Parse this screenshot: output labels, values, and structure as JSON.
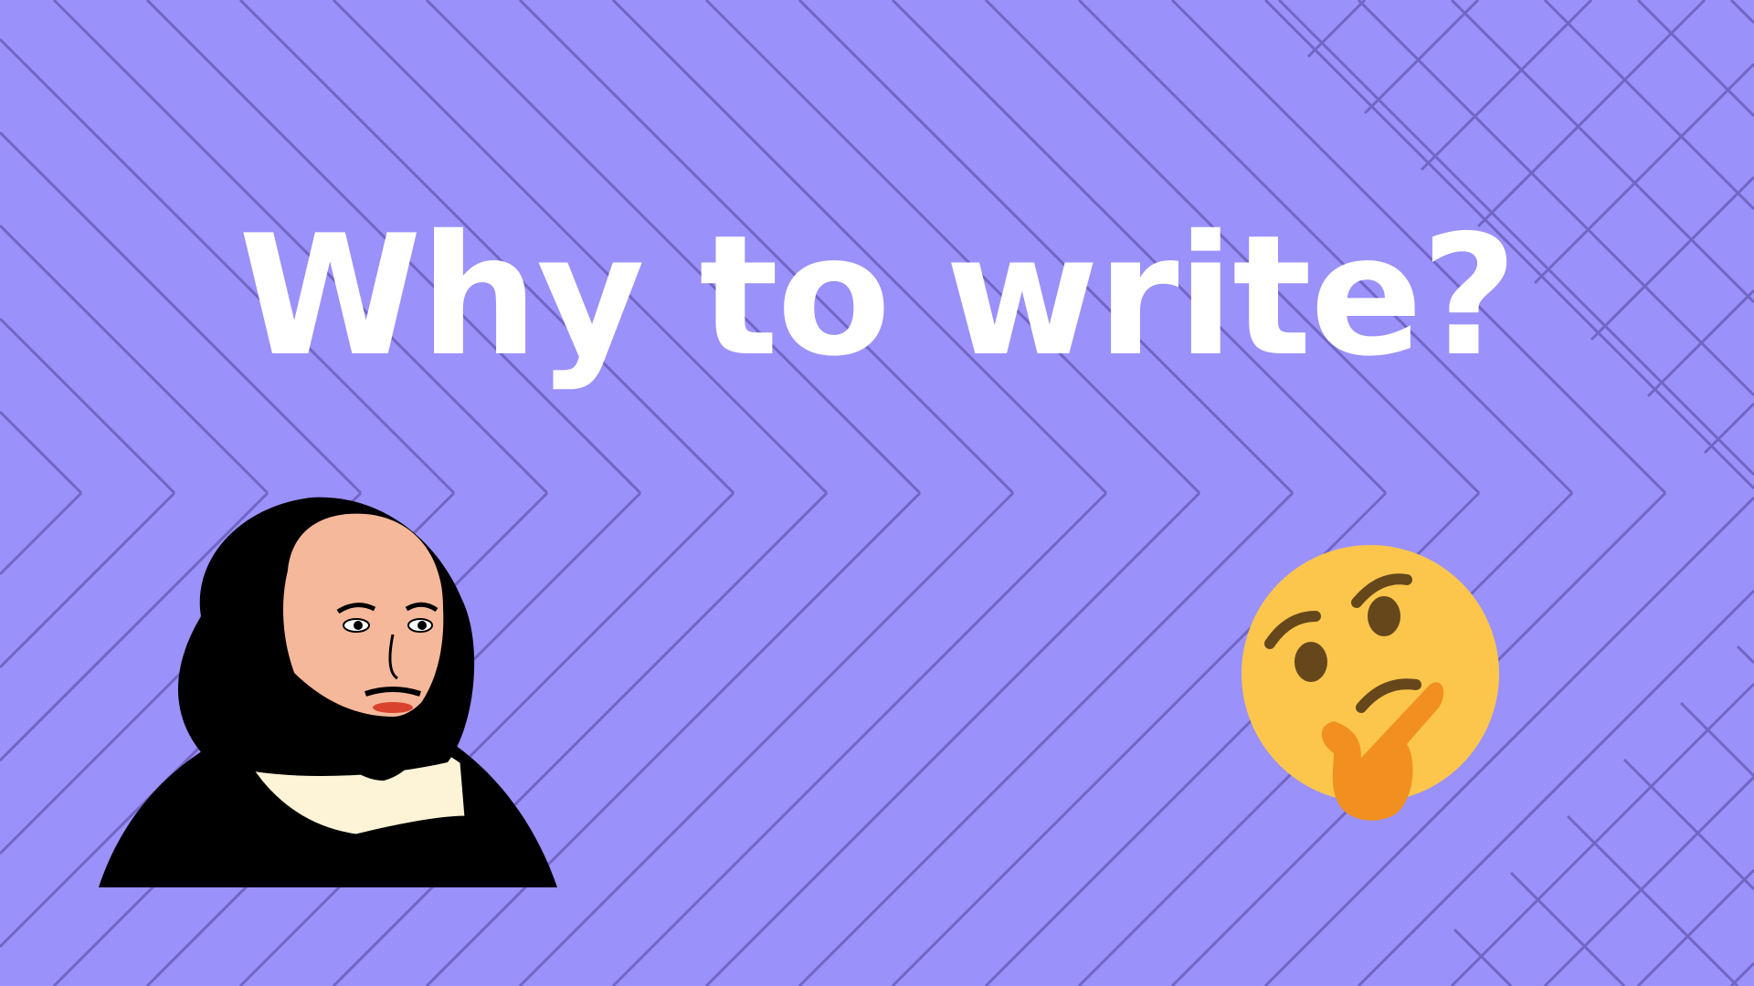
{
  "slide": {
    "title": "Why to write?",
    "colors": {
      "background": "#9b91fb",
      "pattern_lines": "#7166c3",
      "title_text": "#ffffff",
      "emoji_face": "#fcc64c",
      "emoji_hand": "#f19020"
    },
    "illustrations": [
      "shakespeare-portrait",
      "thinking-face-emoji"
    ]
  }
}
